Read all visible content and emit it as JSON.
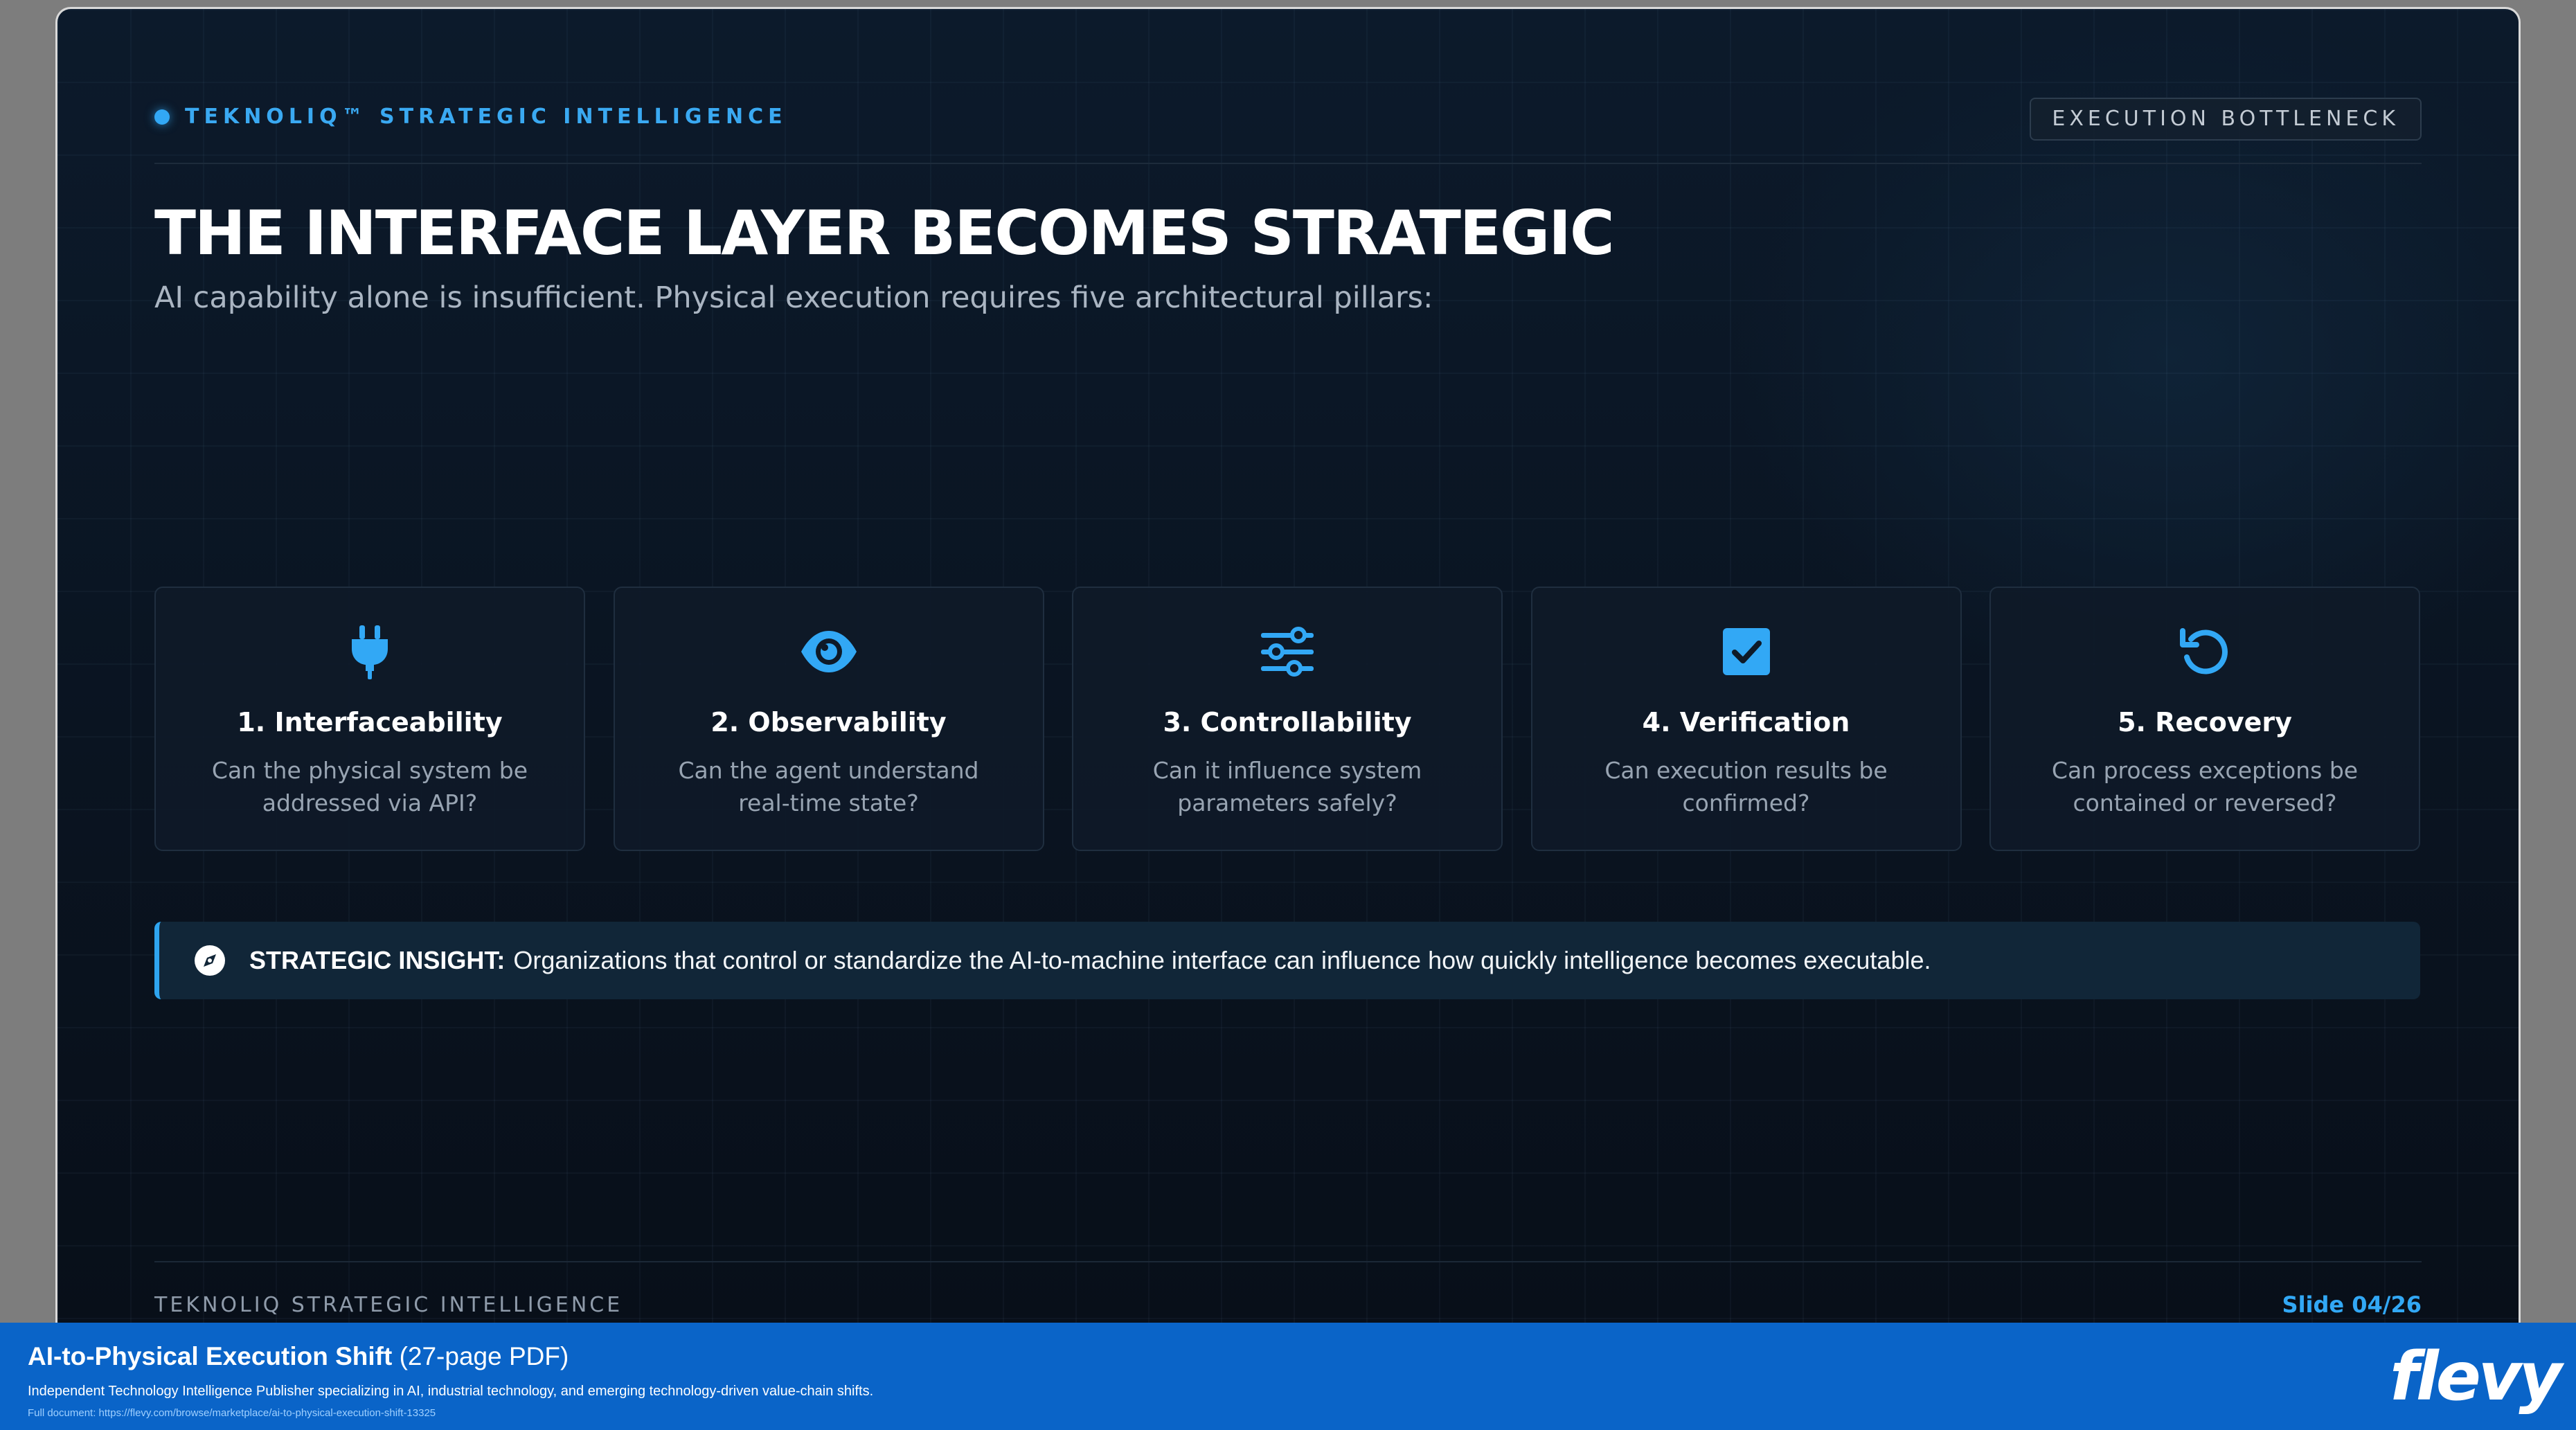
{
  "header": {
    "brand": "TEKNOLIQ™ STRATEGIC INTELLIGENCE",
    "badge": "EXECUTION BOTTLENECK"
  },
  "main": {
    "title": "THE INTERFACE LAYER BECOMES STRATEGIC",
    "subtitle": "AI capability alone is insufficient. Physical execution requires five architectural pillars:"
  },
  "pillars": [
    {
      "icon": "plug-icon",
      "title": "1. Interfaceability",
      "desc": "Can the physical system be addressed via API?"
    },
    {
      "icon": "eye-icon",
      "title": "2. Observability",
      "desc": "Can the agent understand real-time state?"
    },
    {
      "icon": "sliders-icon",
      "title": "3. Controllability",
      "desc": "Can it influence system parameters safely?"
    },
    {
      "icon": "checkbox-icon",
      "title": "4. Verification",
      "desc": "Can execution results be confirmed?"
    },
    {
      "icon": "rotate-ccw-icon",
      "title": "5. Recovery",
      "desc": "Can process exceptions be contained or reversed?"
    }
  ],
  "insight": {
    "icon": "compass-icon",
    "label": "STRATEGIC INSIGHT:",
    "text": "Organizations that control or standardize the AI-to-machine interface can influence how quickly intelligence becomes executable."
  },
  "footer": {
    "brand": "TEKNOLIQ STRATEGIC INTELLIGENCE",
    "slide": "Slide 04/26"
  },
  "banner": {
    "title": "AI-to-Physical Execution Shift",
    "pages": "(27-page PDF)",
    "description": "Independent Technology Intelligence Publisher specializing in AI, industrial technology, and emerging technology-driven value-chain shifts.",
    "link": "Full document: https://flevy.com/browse/marketplace/ai-to-physical-execution-shift-13325",
    "logo": "flevy"
  },
  "colors": {
    "accent": "#32a8f5",
    "background": "#0a1421",
    "banner": "#0a64c8"
  }
}
